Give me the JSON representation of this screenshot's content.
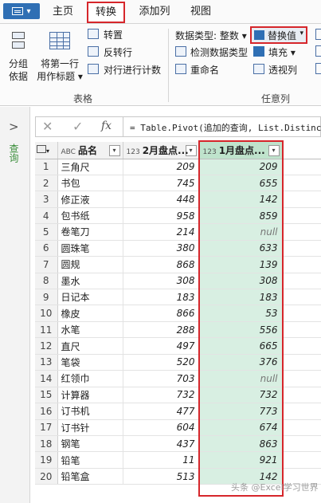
{
  "tabs": {
    "file_menu": "",
    "home": "主页",
    "transform": "转换",
    "add_column": "添加列",
    "view": "视图"
  },
  "ribbon": {
    "table_group": {
      "group_by_line1": "分组",
      "group_by_line2": "依据",
      "first_row_line1": "将第一行",
      "first_row_line2": "用作标题",
      "transpose": "转置",
      "reverse_rows": "反转行",
      "count_rows": "对行进行计数",
      "label": "表格"
    },
    "any_column_group": {
      "data_type": "数据类型: 整数",
      "detect_type": "检测数据类型",
      "rename": "重命名",
      "replace_values": "替换值",
      "fill": "填充",
      "pivot": "透视列",
      "label": "任意列"
    }
  },
  "queries_pane": {
    "title": "查询"
  },
  "formula_bar": {
    "cancel": "✕",
    "confirm": "✓",
    "fx": "fx",
    "formula": "= Table.Pivot(追加的查询, List.Distinct(追加的查询[月份]), \"月份\", \"数量\")"
  },
  "table": {
    "columns": [
      {
        "type": "ABC",
        "name": "品名"
      },
      {
        "type": "123",
        "name": "2月盘点..."
      },
      {
        "type": "123",
        "name": "1月盘点..."
      }
    ],
    "rows": [
      {
        "n": "1",
        "name": "三角尺",
        "feb": "209",
        "jan": "209"
      },
      {
        "n": "2",
        "name": "书包",
        "feb": "745",
        "jan": "655"
      },
      {
        "n": "3",
        "name": "修正液",
        "feb": "448",
        "jan": "142"
      },
      {
        "n": "4",
        "name": "包书纸",
        "feb": "958",
        "jan": "859"
      },
      {
        "n": "5",
        "name": "卷笔刀",
        "feb": "214",
        "jan": "null"
      },
      {
        "n": "6",
        "name": "圆珠笔",
        "feb": "380",
        "jan": "633"
      },
      {
        "n": "7",
        "name": "圆规",
        "feb": "868",
        "jan": "139"
      },
      {
        "n": "8",
        "name": "墨水",
        "feb": "308",
        "jan": "308"
      },
      {
        "n": "9",
        "name": "日记本",
        "feb": "183",
        "jan": "183"
      },
      {
        "n": "10",
        "name": "橡皮",
        "feb": "866",
        "jan": "53"
      },
      {
        "n": "11",
        "name": "水笔",
        "feb": "288",
        "jan": "556"
      },
      {
        "n": "12",
        "name": "直尺",
        "feb": "497",
        "jan": "665"
      },
      {
        "n": "13",
        "name": "笔袋",
        "feb": "520",
        "jan": "376"
      },
      {
        "n": "14",
        "name": "红领巾",
        "feb": "703",
        "jan": "null"
      },
      {
        "n": "15",
        "name": "计算器",
        "feb": "732",
        "jan": "732"
      },
      {
        "n": "16",
        "name": "订书机",
        "feb": "477",
        "jan": "773"
      },
      {
        "n": "17",
        "name": "订书针",
        "feb": "604",
        "jan": "674"
      },
      {
        "n": "18",
        "name": "钢笔",
        "feb": "437",
        "jan": "863"
      },
      {
        "n": "19",
        "name": "铅笔",
        "feb": "11",
        "jan": "921"
      },
      {
        "n": "20",
        "name": "铅笔盒",
        "feb": "513",
        "jan": "142"
      }
    ]
  },
  "watermark": "头条 @Excel学习世界",
  "colors": {
    "highlight_red": "#d6262b",
    "selected_column": "#d8efe2",
    "file_button": "#2f6fb4"
  }
}
